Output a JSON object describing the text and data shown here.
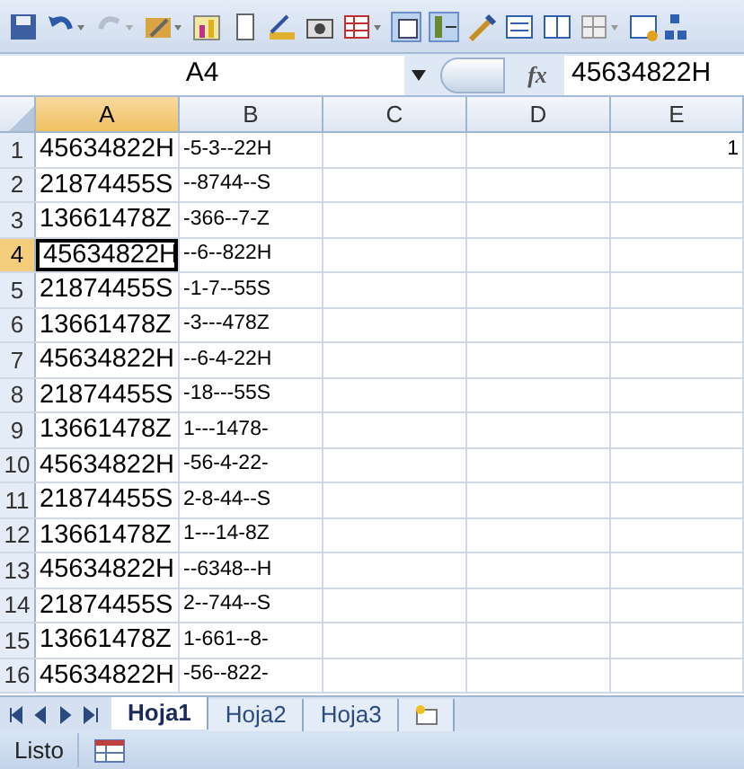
{
  "name_box": {
    "value": "A4"
  },
  "formula_bar": {
    "label": "fx",
    "value": "45634822H"
  },
  "columns": [
    {
      "label": "A",
      "selected": true
    },
    {
      "label": "B",
      "selected": false
    },
    {
      "label": "C",
      "selected": false
    },
    {
      "label": "D",
      "selected": false
    },
    {
      "label": "E",
      "selected": false
    }
  ],
  "rows": [
    {
      "number": "1",
      "selected": false,
      "cells": {
        "A": "45634822H",
        "B": "-5-3--22H",
        "E": "1"
      }
    },
    {
      "number": "2",
      "selected": false,
      "cells": {
        "A": "21874455S",
        "B": "--8744--S"
      }
    },
    {
      "number": "3",
      "selected": false,
      "cells": {
        "A": "13661478Z",
        "B": "-366--7-Z"
      }
    },
    {
      "number": "4",
      "selected": true,
      "cells": {
        "A": "45634822H",
        "B": "--6--822H"
      }
    },
    {
      "number": "5",
      "selected": false,
      "cells": {
        "A": "21874455S",
        "B": "-1-7--55S"
      }
    },
    {
      "number": "6",
      "selected": false,
      "cells": {
        "A": "13661478Z",
        "B": "-3---478Z"
      }
    },
    {
      "number": "7",
      "selected": false,
      "cells": {
        "A": "45634822H",
        "B": "--6-4-22H"
      }
    },
    {
      "number": "8",
      "selected": false,
      "cells": {
        "A": "21874455S",
        "B": "-18---55S"
      }
    },
    {
      "number": "9",
      "selected": false,
      "cells": {
        "A": "13661478Z",
        "B": "1---1478-"
      }
    },
    {
      "number": "10",
      "selected": false,
      "cells": {
        "A": "45634822H",
        "B": "-56-4-22-"
      }
    },
    {
      "number": "11",
      "selected": false,
      "cells": {
        "A": "21874455S",
        "B": "2-8-44--S"
      }
    },
    {
      "number": "12",
      "selected": false,
      "cells": {
        "A": "13661478Z",
        "B": "1---14-8Z"
      }
    },
    {
      "number": "13",
      "selected": false,
      "cells": {
        "A": "45634822H",
        "B": "--6348--H"
      }
    },
    {
      "number": "14",
      "selected": false,
      "cells": {
        "A": "21874455S",
        "B": "2--744--S"
      }
    },
    {
      "number": "15",
      "selected": false,
      "cells": {
        "A": "13661478Z",
        "B": "1-661--8-"
      }
    },
    {
      "number": "16",
      "selected": false,
      "cells": {
        "A": "45634822H",
        "B": "-56--822-"
      }
    }
  ],
  "sheet_tabs": [
    {
      "label": "Hoja1",
      "selected": true
    },
    {
      "label": "Hoja2",
      "selected": false
    },
    {
      "label": "Hoja3",
      "selected": false
    }
  ],
  "status_bar": {
    "text": "Listo"
  }
}
